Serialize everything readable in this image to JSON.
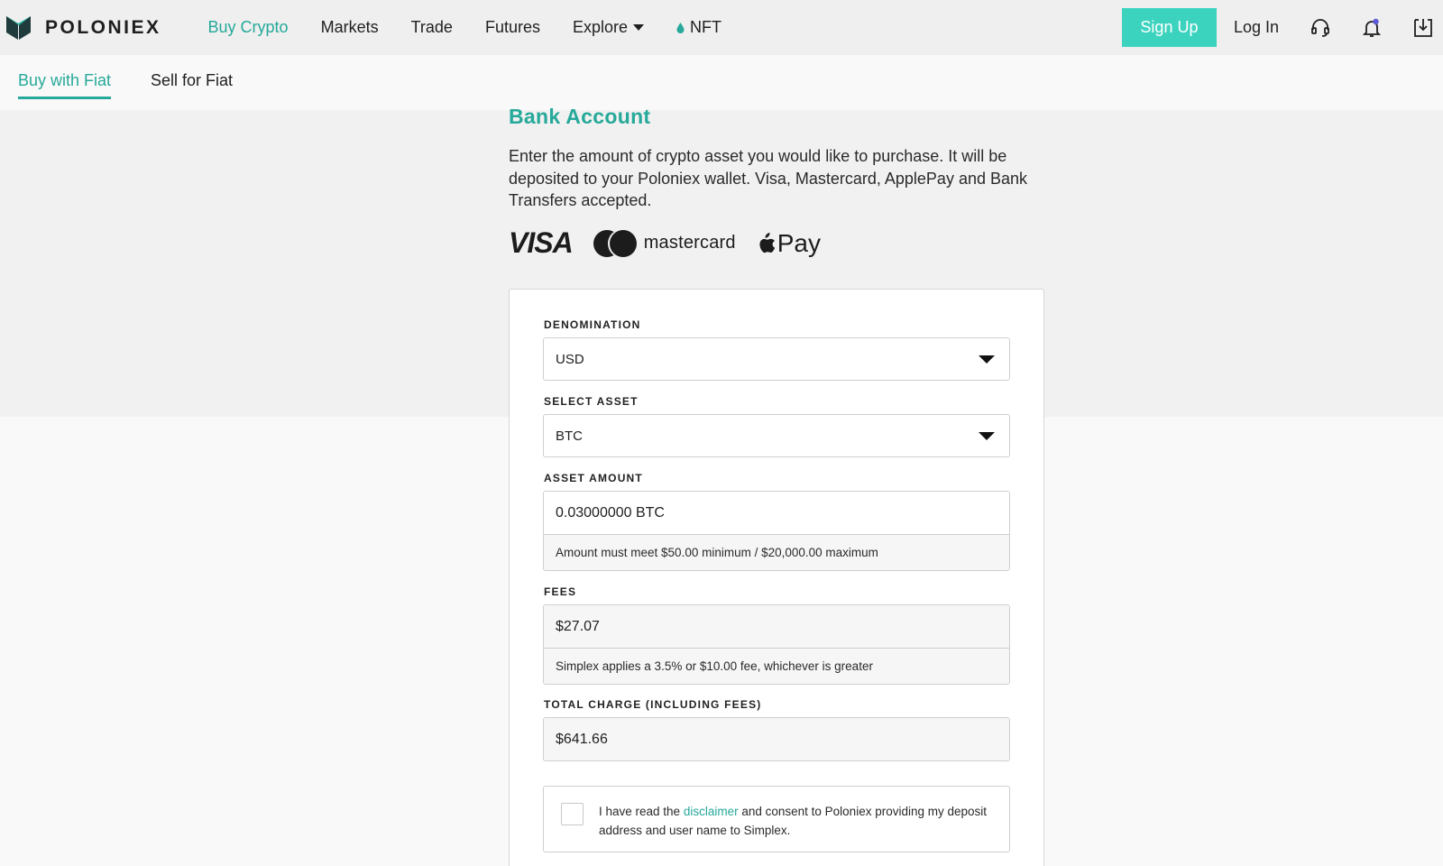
{
  "header": {
    "brand": "POLONIEX",
    "nav": [
      {
        "label": "Buy Crypto",
        "active": true
      },
      {
        "label": "Markets"
      },
      {
        "label": "Trade"
      },
      {
        "label": "Futures"
      },
      {
        "label": "Explore"
      },
      {
        "label": "NFT"
      }
    ],
    "signup_label": "Sign Up",
    "login_label": "Log In",
    "icons": [
      "headset-icon",
      "bell-icon",
      "download-icon"
    ]
  },
  "subnav": {
    "tabs": [
      {
        "label": "Buy with Fiat",
        "active": true
      },
      {
        "label": "Sell for Fiat"
      }
    ]
  },
  "main": {
    "title": "Bank Account",
    "intro": "Enter the amount of crypto asset you would like to purchase. It will be deposited to your Poloniex wallet. Visa, Mastercard, ApplePay and Bank Transfers accepted.",
    "brands": {
      "visa": "VISA",
      "mastercard": "mastercard",
      "applepay": "Pay"
    }
  },
  "form": {
    "denomination": {
      "label": "DENOMINATION",
      "value": "USD"
    },
    "asset": {
      "label": "SELECT ASSET",
      "value": "BTC"
    },
    "amount": {
      "label": "ASSET AMOUNT",
      "value": "0.03000000 BTC",
      "hint": "Amount must meet $50.00 minimum / $20,000.00 maximum"
    },
    "fees": {
      "label": "FEES",
      "value": "$27.07",
      "hint": "Simplex applies a 3.5% or $10.00 fee, whichever is greater"
    },
    "total": {
      "label": "TOTAL CHARGE (INCLUDING FEES)",
      "value": "$641.66"
    },
    "consent": {
      "before": "I have read the ",
      "link": "disclaimer",
      "after": " and consent to Poloniex providing my deposit address and user name to Simplex.",
      "checked": false
    }
  },
  "colors": {
    "accent": "#26a99a",
    "signup_bg": "#3cd3be",
    "notification_dot": "#5b5bd6"
  }
}
